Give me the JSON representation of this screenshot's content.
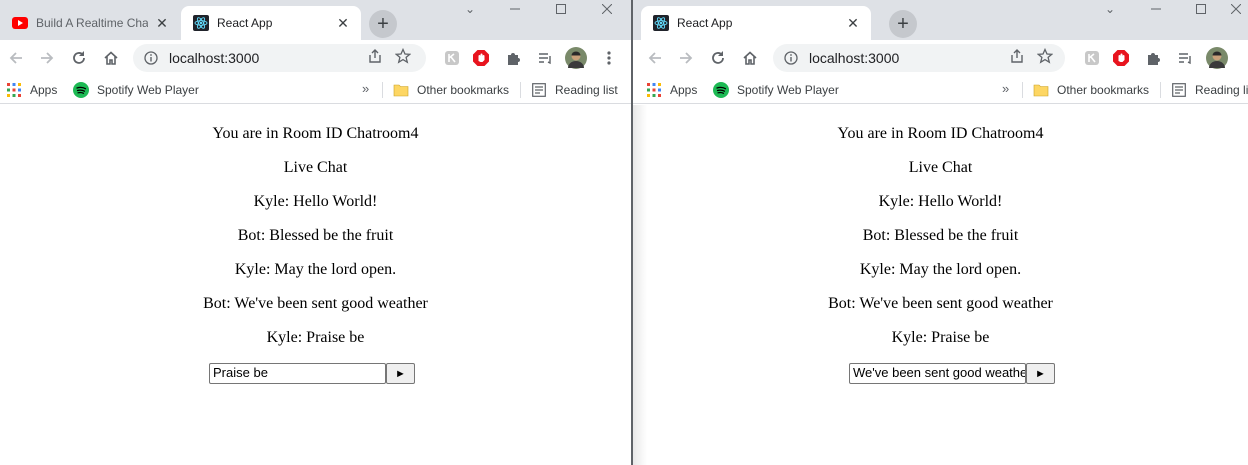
{
  "windows": [
    {
      "tabs": [
        {
          "title": "Build A Realtime Chat",
          "favicon": "youtube-icon",
          "active": false
        },
        {
          "title": "React App",
          "favicon": "react-icon",
          "active": true
        }
      ],
      "url": "localhost:3000",
      "bookmarks": {
        "apps": "Apps",
        "spotify": "Spotify Web Player",
        "other": "Other bookmarks",
        "reading": "Reading list"
      },
      "room_text": "You are in Room ID Chatroom4",
      "header": "Live Chat",
      "messages": [
        "Kyle: Hello World!",
        "Bot: Blessed be the fruit",
        "Kyle: May the lord open.",
        "Bot: We've been sent good weather",
        "Kyle: Praise be"
      ],
      "input_value": "Praise be",
      "send_label": "►"
    },
    {
      "tabs": [
        {
          "title": "React App",
          "favicon": "react-icon",
          "active": true
        }
      ],
      "url": "localhost:3000",
      "bookmarks": {
        "apps": "Apps",
        "spotify": "Spotify Web Player",
        "other": "Other bookmarks",
        "reading": "Reading list"
      },
      "room_text": "You are in Room ID Chatroom4",
      "header": "Live Chat",
      "messages": [
        "Kyle: Hello World!",
        "Bot: Blessed be the fruit",
        "Kyle: May the lord open.",
        "Bot: We've been sent good weather",
        "Kyle: Praise be"
      ],
      "input_value": "We've been sent good weather",
      "send_label": "►"
    }
  ],
  "colors": {
    "tabstrip": "#dee1e6",
    "youtube": "#ff0000",
    "react": "#61dafb",
    "spotify": "#1db954",
    "adblock": "#e8141e"
  }
}
